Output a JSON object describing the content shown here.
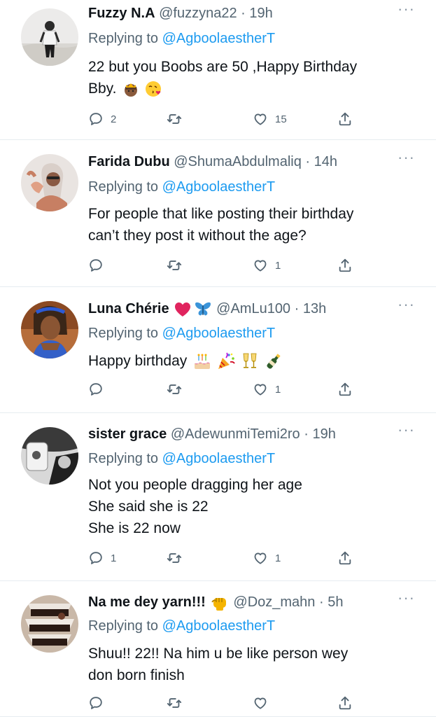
{
  "tweets": [
    {
      "name": "Fuzzy N.A",
      "name_emoji": [],
      "handle": "@fuzzyna22",
      "dot": "·",
      "time": "19h",
      "reply_prefix": "Replying to ",
      "reply_to": "@AgboolaestherT",
      "body_lines": [
        "22 but you Boobs are 50 ,Happy Birthday",
        "Bby."
      ],
      "body_emoji": [
        "princess-emoji",
        "kiss-emoji"
      ],
      "replies": "2",
      "retweets": "",
      "likes": "15"
    },
    {
      "name": "Farida Dubu",
      "name_emoji": [],
      "handle": "@ShumaAbdulmaliq",
      "dot": "·",
      "time": "14h",
      "reply_prefix": "Replying to ",
      "reply_to": "@AgboolaestherT",
      "body_lines": [
        "For people that like posting their birthday",
        "can’t they post it without the age?"
      ],
      "body_emoji": [],
      "replies": "",
      "retweets": "",
      "likes": "1"
    },
    {
      "name": "Luna Chérie",
      "name_emoji": [
        "red-heart-emoji",
        "butterfly-emoji"
      ],
      "handle": "@AmLu100",
      "dot": "·",
      "time": "13h",
      "reply_prefix": "Replying to ",
      "reply_to": "@AgboolaestherT",
      "body_lines": [
        "Happy birthday"
      ],
      "body_emoji": [
        "cake-emoji",
        "party-popper-emoji",
        "clinking-glasses-emoji",
        "champagne-emoji"
      ],
      "replies": "",
      "retweets": "",
      "likes": "1"
    },
    {
      "name": "sister grace",
      "name_emoji": [],
      "handle": "@AdewunmiTemi2ro",
      "dot": "·",
      "time": "19h",
      "reply_prefix": "Replying to ",
      "reply_to": "@AgboolaestherT",
      "body_lines": [
        "Not you people dragging her age",
        "She said she is 22",
        "She is 22 now"
      ],
      "body_emoji": [],
      "replies": "1",
      "retweets": "",
      "likes": "1"
    },
    {
      "name": "Na me dey yarn!!!",
      "name_emoji": [
        "fist-emoji"
      ],
      "handle": "@Doz_mahn",
      "dot": "·",
      "time": "5h",
      "reply_prefix": "Replying to ",
      "reply_to": "@AgboolaestherT",
      "body_lines": [
        "Shuu!!  22!!  Na him u be like person wey",
        "don born finish"
      ],
      "body_emoji": [],
      "replies": "",
      "retweets": "",
      "likes": ""
    }
  ],
  "more_glyph": "···",
  "colors": {
    "link": "#1d9bf0",
    "muted": "#536471",
    "text": "#0f1419",
    "divider": "#e6ecf0"
  }
}
